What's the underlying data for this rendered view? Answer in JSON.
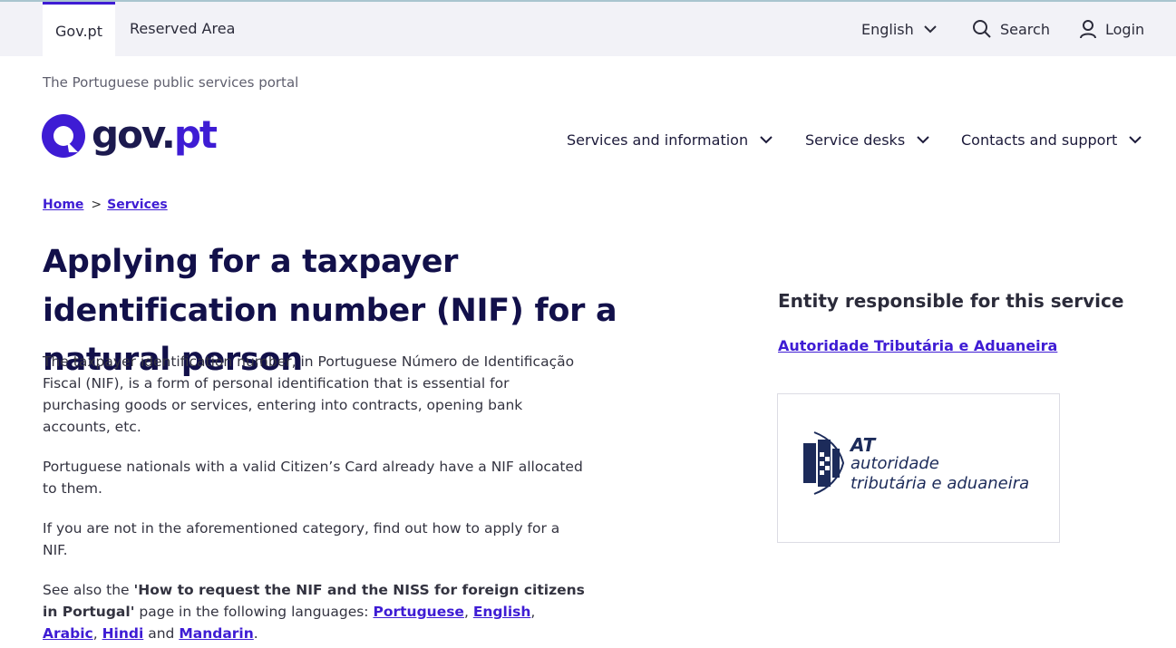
{
  "topbar": {
    "tab_govpt": "Gov.pt",
    "tab_reserved": "Reserved Area",
    "language": "English",
    "search": "Search",
    "login": "Login"
  },
  "tagline": "The Portuguese public services portal",
  "logo": {
    "word_main": "gov",
    "word_dot": ".",
    "word_pt": "pt"
  },
  "nav": {
    "services": "Services and information",
    "desks": "Service desks",
    "contacts": "Contacts and support"
  },
  "breadcrumb": {
    "home": "Home",
    "sep": ">",
    "services": "Services"
  },
  "page_title": "Applying for a taxpayer identification number (NIF) for a natural person",
  "content": {
    "p1": "The taxpayer identification number, in Portuguese Número de Identificação Fiscal (NIF), is a form of personal identification that is essential for purchasing goods or services, entering into contracts, opening bank accounts, etc.",
    "p2": "Portuguese nationals with a valid Citizen’s Card already have a NIF allocated to them.",
    "p3": "If you are not in the aforementioned category, find out how to apply for a NIF.",
    "p4_pre": "See also the ",
    "p4_bold": "'How to request the NIF and the NISS for foreign citizens in Portugal'",
    "p4_mid": " page in the following languages: ",
    "lang_pt": "Portuguese",
    "comma1": ", ",
    "lang_en": "English",
    "comma2": ", ",
    "lang_ar": "Arabic",
    "comma3": ", ",
    "lang_hi": "Hindi",
    "and": " and ",
    "lang_zh": "Mandarin",
    "end": "."
  },
  "entity": {
    "heading": "Entity responsible for this service",
    "link": "Autoridade Tributária e Aduaneira",
    "logo_at": "AT",
    "logo_line1": "autoridade",
    "logo_line2": "tributária e aduaneira"
  },
  "colors": {
    "accent": "#3e1cd4",
    "title": "#12104a",
    "topbar_bg": "#f2f2f7"
  }
}
